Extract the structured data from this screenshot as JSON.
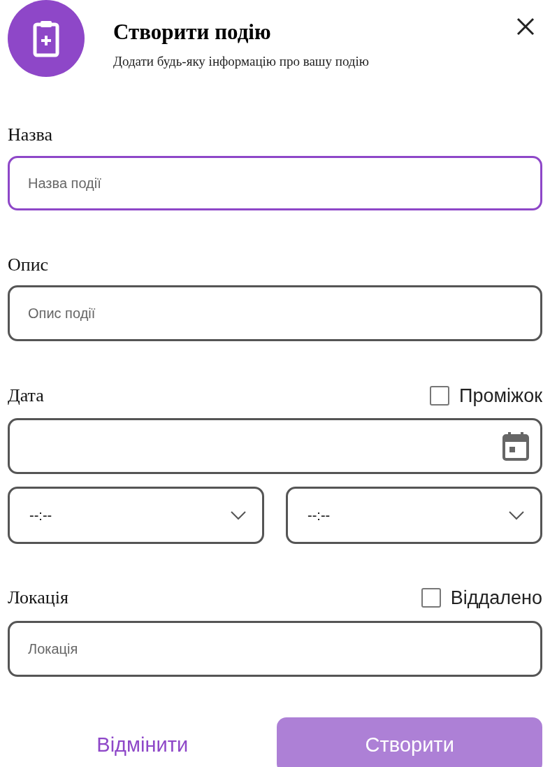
{
  "header": {
    "title": "Створити подію",
    "subtitle": "Додати будь-яку інформацію про вашу подію"
  },
  "name": {
    "label": "Назва",
    "placeholder": "Назва події",
    "focused": true
  },
  "description": {
    "label": "Опис",
    "placeholder": "Опис події",
    "focused": false
  },
  "date": {
    "label": "Дата",
    "focused": false,
    "range": {
      "label": "Проміжок",
      "checked": false
    }
  },
  "times": [
    {
      "value": "--:--",
      "focused": false
    },
    {
      "value": "--:--",
      "focused": false
    }
  ],
  "location": {
    "label": "Локація",
    "placeholder": "Локація",
    "focused": false,
    "remote": {
      "label": "Віддалено",
      "checked": false
    }
  },
  "buttons": {
    "cancel": "Відмінити",
    "submit": {
      "label": "Створити",
      "disabled": true
    }
  }
}
